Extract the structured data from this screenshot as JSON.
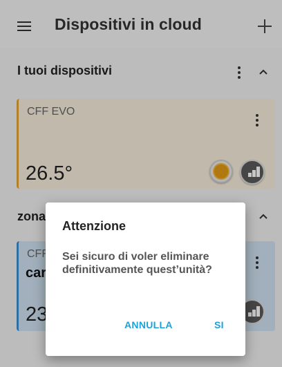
{
  "header": {
    "title": "Dispositivi in cloud",
    "menu_icon": "hamburger-menu-icon",
    "add_icon": "plus-icon"
  },
  "sections": [
    {
      "title": "I tuoi dispositivi",
      "expanded": true,
      "card": {
        "label": "CFF EVO",
        "temperature": "26.5°",
        "accent_color": "#e3a432",
        "background_color": "#f7eedd",
        "icons": [
          "sun-mode-icon",
          "stats-chart-icon"
        ]
      }
    },
    {
      "title": "zona",
      "expanded": true,
      "card": {
        "label": "CFF",
        "name": "car",
        "temperature": "23",
        "accent_color": "#3a8fd0",
        "background_color": "#cfe2f1",
        "icons": [
          "stats-chart-icon"
        ]
      }
    }
  ],
  "dialog": {
    "title": "Attenzione",
    "message": "Sei sicuro di voler eliminare definitivamente quest’unità?",
    "cancel_label": "ANNULLA",
    "confirm_label": "SI",
    "button_color": "#1aa3d9"
  }
}
